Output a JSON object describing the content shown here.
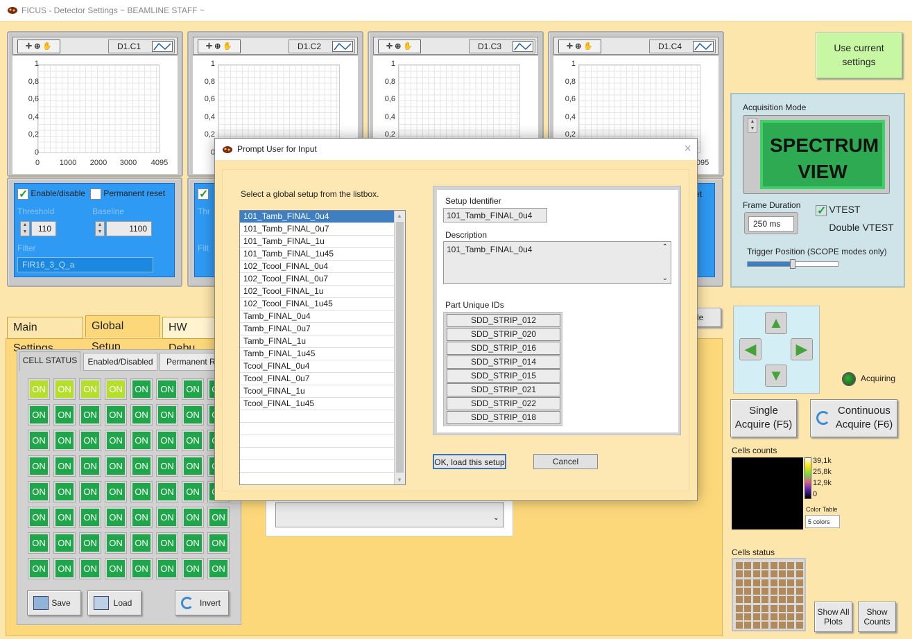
{
  "window": {
    "title": "FICUS - Detector Settings ~ BEAMLINE STAFF ~"
  },
  "plots": [
    {
      "name": "D1.C1"
    },
    {
      "name": "D1.C2"
    },
    {
      "name": "D1.C3"
    },
    {
      "name": "D1.C4"
    }
  ],
  "plot_axes": {
    "y_ticks": [
      "1",
      "0,8",
      "0,6",
      "0,4",
      "0,2",
      "0"
    ],
    "x_ticks": [
      "0",
      "1000",
      "2000",
      "3000",
      "4095"
    ]
  },
  "channel_panel": {
    "enable_label": "Enable/disable",
    "permanent_reset_label": "Permanent reset",
    "threshold_label": "Threshold",
    "threshold_value": "110",
    "baseline_label": "Baseline",
    "baseline_value": "1100",
    "filter_label": "Filter",
    "filter_value": "FIR16_3_Q_a"
  },
  "channel_panel_2": {
    "partial_reset": "set",
    "partial_threshold": "Thr",
    "partial_filter": "Filt"
  },
  "right": {
    "use_current": "Use current settings",
    "acq_mode_label": "Acquisition Mode",
    "acq_mode_value": "SPECTRUM VIEW",
    "frame_duration_label": "Frame Duration",
    "frame_duration_value": "250 ms",
    "vtest_label": "VTEST",
    "double_vtest_label": "Double VTEST",
    "trigger_label": "Trigger Position (SCOPE modes only)",
    "trigger_level": 0.5,
    "acquiring_label": "Acquiring",
    "single_acquire": "Single Acquire (F5)",
    "continuous_acquire": "Continuous Acquire (F6)",
    "cells_counts_label": "Cells counts",
    "scale_ticks": [
      "39,1k",
      "25,8k",
      "12,9k",
      "0"
    ],
    "color_table_label": "Color Table",
    "color_table_value": "5 colors",
    "cells_status_label": "Cells status",
    "show_all_plots": "Show All Plots",
    "show_counts": "Show Counts"
  },
  "tabs": {
    "main_settings": "Main Settings",
    "global_setup": "Global Setup",
    "hw_debug": "HW Debu",
    "partial_button": "le"
  },
  "subtabs": {
    "cell_status": "CELL STATUS",
    "enabled_disabled": "Enabled/Disabled",
    "permanent_reset": "Permanent R"
  },
  "cell_grid": {
    "label": "ON",
    "rows": 8,
    "highlighted": [
      0,
      1,
      2,
      3
    ]
  },
  "bottom_buttons": {
    "save": "Save",
    "load": "Load",
    "invert": "Invert"
  },
  "dialog": {
    "title": "Prompt User for Input",
    "instruction": "Select a global setup from the listbox.",
    "setups": [
      "101_Tamb_FINAL_0u4",
      "101_Tamb_FINAL_0u7",
      "101_Tamb_FINAL_1u",
      "101_Tamb_FINAL_1u45",
      "102_Tcool_FINAL_0u4",
      "102_Tcool_FINAL_0u7",
      "102_Tcool_FINAL_1u",
      "102_Tcool_FINAL_1u45",
      "Tamb_FINAL_0u4",
      "Tamb_FINAL_0u7",
      "Tamb_FINAL_1u",
      "Tamb_FINAL_1u45",
      "Tcool_FINAL_0u4",
      "Tcool_FINAL_0u7",
      "Tcool_FINAL_1u",
      "Tcool_FINAL_1u45"
    ],
    "selected_index": 0,
    "setup_identifier_label": "Setup Identifier",
    "setup_identifier_value": "101_Tamb_FINAL_0u4",
    "description_label": "Description",
    "description_value": "101_Tamb_FINAL_0u4",
    "part_ids_label": "Part Unique IDs",
    "part_ids": [
      "SDD_STRIP_012",
      "SDD_STRIP_020",
      "SDD_STRIP_016",
      "SDD_STRIP_014",
      "SDD_STRIP_015",
      "SDD_STRIP_021",
      "SDD_STRIP_022",
      "SDD_STRIP_018"
    ],
    "ok_button": "OK, load this setup",
    "cancel_button": "Cancel"
  }
}
